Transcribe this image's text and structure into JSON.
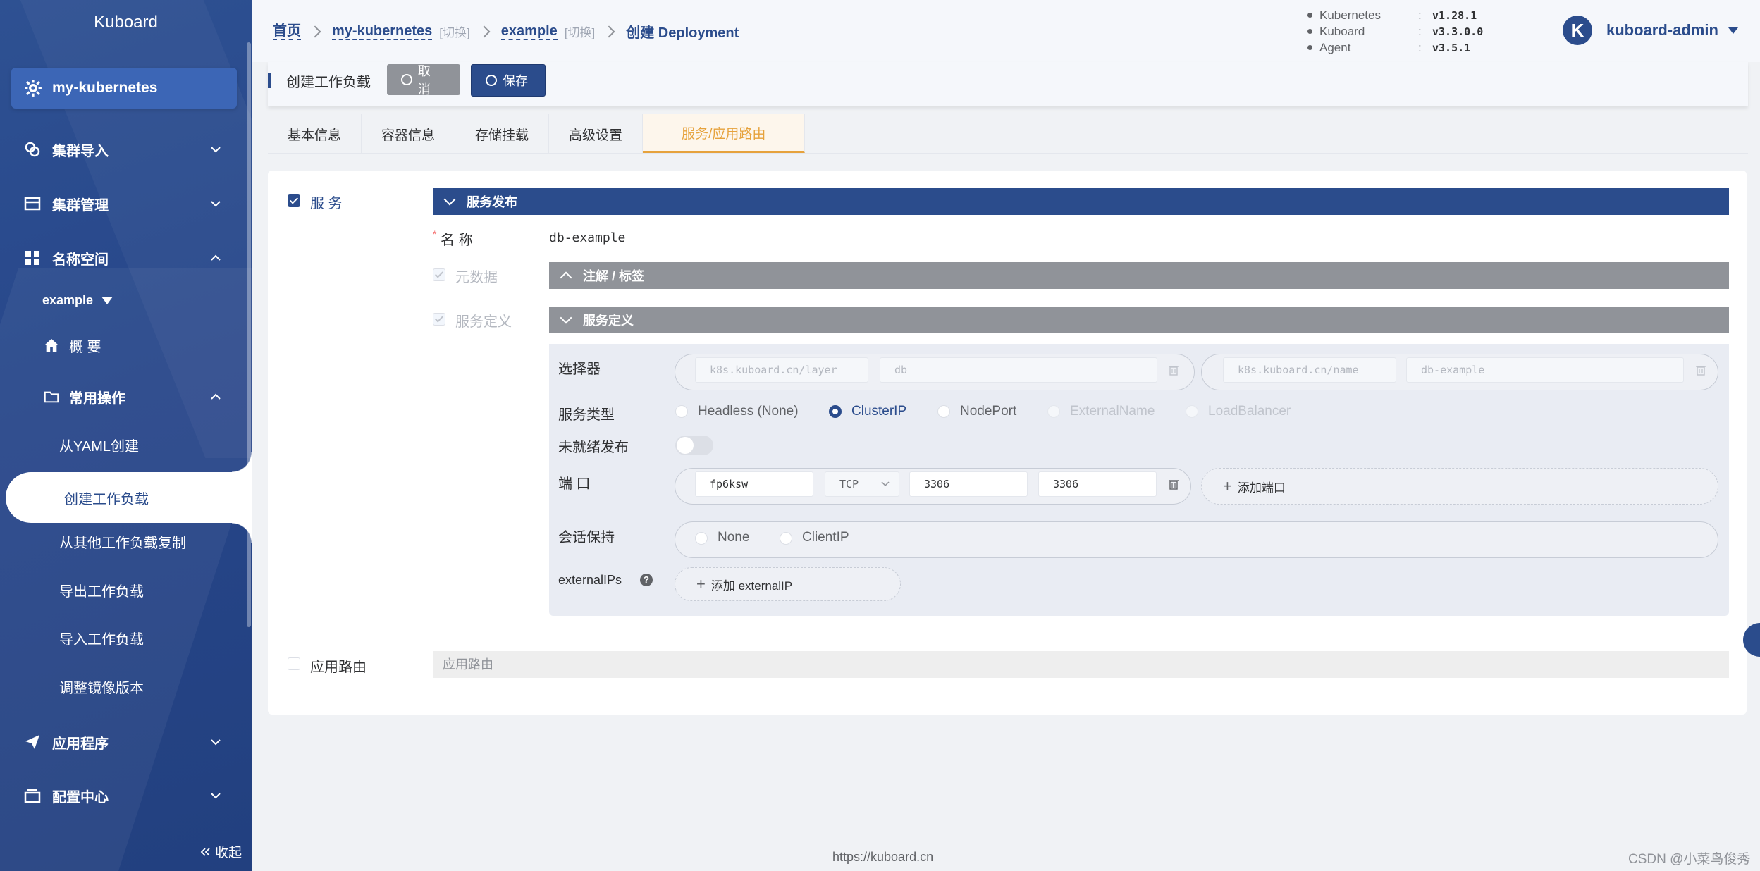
{
  "sidebar": {
    "logo": "Kuboard",
    "cluster": "my-kubernetes",
    "menu": {
      "cluster_import": "集群导入",
      "cluster_manage": "集群管理",
      "namespace": "名称空间",
      "namespace_value": "example",
      "overview": "概 要",
      "common_ops": "常用操作",
      "from_yaml": "从YAML创建",
      "create_workload": "创建工作负载",
      "copy_workload": "从其他工作负载复制",
      "export_workload": "导出工作负载",
      "import_workload": "导入工作负载",
      "adjust_image": "调整镜像版本",
      "applications": "应用程序",
      "config_center": "配置中心"
    },
    "collapse": "收起"
  },
  "header": {
    "breadcrumb": {
      "home": "首页",
      "cluster": "my-kubernetes",
      "switch": "[切换]",
      "namespace": "example",
      "current": "创建 Deployment"
    },
    "versions": [
      {
        "name": "Kubernetes",
        "value": "v1.28.1"
      },
      {
        "name": "Kuboard",
        "value": "v3.3.0.0"
      },
      {
        "name": "Agent",
        "value": "v3.5.1"
      }
    ],
    "avatar_letter": "K",
    "user": "kuboard-admin"
  },
  "toolbar": {
    "title": "创建工作负载",
    "cancel": "取 消",
    "save": "保存"
  },
  "tabs": [
    "基本信息",
    "容器信息",
    "存储挂载",
    "高级设置",
    "服务/应用路由"
  ],
  "form": {
    "service_label": "服 务",
    "service_publish": "服务发布",
    "name_label": "名 称",
    "name_value": "db-example",
    "metadata_label": "元数据",
    "annotations_header": "注解 / 标签",
    "service_def_label": "服务定义",
    "service_def_header": "服务定义",
    "selector_label": "选择器",
    "selectors": [
      {
        "key": "k8s.kuboard.cn/layer",
        "value": "db"
      },
      {
        "key": "k8s.kuboard.cn/name",
        "value": "db-example"
      }
    ],
    "service_type_label": "服务类型",
    "service_types": [
      "Headless (None)",
      "ClusterIP",
      "NodePort",
      "ExternalName",
      "LoadBalancer"
    ],
    "unready_label": "未就绪发布",
    "port_label": "端 口",
    "port": {
      "name": "fp6ksw",
      "protocol": "TCP",
      "port": "3306",
      "target": "3306"
    },
    "add_port": "添加端口",
    "session_label": "会话保持",
    "session_options": [
      "None",
      "ClientIP"
    ],
    "external_label": "externalIPs",
    "help_mark": "?",
    "add_external": "添加 externalIP",
    "ingress_label": "应用路由",
    "ingress_placeholder": "应用路由"
  },
  "footer": "https://kuboard.cn",
  "watermark": "CSDN @小菜鸟俊秀",
  "colors": {
    "primary": "#2b4c8c",
    "accent": "#e6a23c",
    "gray_header": "#909399"
  }
}
